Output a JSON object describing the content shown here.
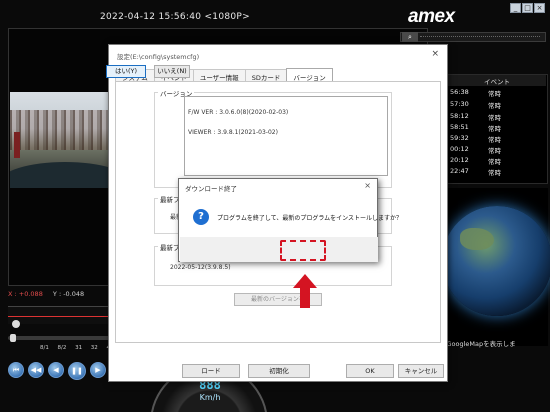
{
  "player": {
    "timestamp": "2022-04-12 15:56:40 <1080P>",
    "axis_x": "X : +0.088",
    "axis_y": "Y : -0.048",
    "speed_labels": [
      "8/1",
      "8/2",
      "31",
      "32",
      "4"
    ],
    "speed_value": "888",
    "speed_unit": "Km/h",
    "controls": [
      "⏮",
      "◀◀",
      "◀",
      "❚❚",
      "▶",
      "▶▶"
    ]
  },
  "right_panel": {
    "logo": "amex",
    "window_buttons": [
      "_",
      "□",
      "×"
    ],
    "event_header": "イベント",
    "events": [
      {
        "time": "56:38",
        "event": "常時"
      },
      {
        "time": "57:30",
        "event": "常時"
      },
      {
        "time": "58:12",
        "event": "常時"
      },
      {
        "time": "58:51",
        "event": "常時"
      },
      {
        "time": "59:32",
        "event": "常時"
      },
      {
        "time": "00:12",
        "event": "常時"
      },
      {
        "time": "20:12",
        "event": "常時"
      },
      {
        "time": "22:47",
        "event": "常時"
      }
    ],
    "googlemap_text": "とGoogleMapを表示しま"
  },
  "settings": {
    "title": "設定(E:\\config\\systemcfg)",
    "close": "×",
    "tabs": [
      "システム",
      "イベント",
      "ユーザー情報",
      "SDカード",
      "バージョン"
    ],
    "version_group": "バージョン",
    "fw_version": "F/W VER : 3.0.6.0(8)(2020-02-03)",
    "viewer_version": "VIEWER : 3.9.8.1(2021-03-02)",
    "latest_fw_group": "最新ファ",
    "latest_fw_text": "最新",
    "latest_viewer_group": "最新ブレ",
    "latest_viewer_value": "2022-05-12(3.9.8.5)",
    "update_button": "最新のバージョンを",
    "load_button": "ロード",
    "init_button": "初期化",
    "ok_button": "OK",
    "cancel_button": "キャンセル"
  },
  "download_dialog": {
    "title": "ダウンロード終了",
    "close": "×",
    "icon_glyph": "?",
    "message": "プログラムを終了して、最新のプログラムをインストールしますか？",
    "yes_button": "はい(Y)",
    "no_button": "いいえ(N)"
  },
  "colors": {
    "highlight": "#d41422",
    "accent_blue": "#1f6fd1"
  }
}
